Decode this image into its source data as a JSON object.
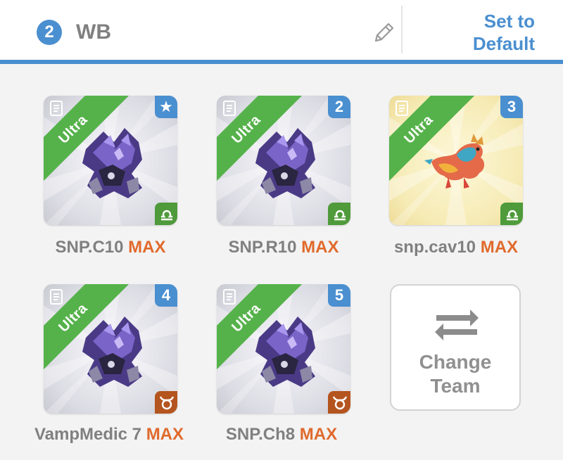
{
  "header": {
    "team_number": "2",
    "team_name": "WB",
    "default_line1": "Set to",
    "default_line2": "Default"
  },
  "colors": {
    "accent": "#4a8fd0",
    "ultra_green": "#55b24a",
    "max_orange": "#e06a2c",
    "label_gray": "#808080"
  },
  "cards": [
    {
      "ultra": "Ultra",
      "badge": "★",
      "name": "SNP.C10",
      "max": "MAX",
      "element_icon": "libra-icon",
      "element_color": "green",
      "background": "silver",
      "monster_icon": "dark-armored-monster-icon"
    },
    {
      "ultra": "Ultra",
      "badge": "2",
      "name": "SNP.R10",
      "max": "MAX",
      "element_icon": "libra-icon",
      "element_color": "green",
      "background": "silver",
      "monster_icon": "dark-armored-monster-icon"
    },
    {
      "ultra": "Ultra",
      "badge": "3",
      "name": "snp.cav10",
      "max": "MAX",
      "element_icon": "libra-icon",
      "element_color": "green",
      "background": "gold",
      "monster_icon": "dragon-monster-icon"
    },
    {
      "ultra": "Ultra",
      "badge": "4",
      "name": "VampMedic 7",
      "max": "MAX",
      "element_icon": "taurus-icon",
      "element_color": "brown",
      "background": "silver",
      "monster_icon": "dark-armored-monster-icon"
    },
    {
      "ultra": "Ultra",
      "badge": "5",
      "name": "SNP.Ch8",
      "max": "MAX",
      "element_icon": "taurus-icon",
      "element_color": "brown",
      "background": "silver",
      "monster_icon": "dark-armored-monster-icon"
    }
  ],
  "change_team": {
    "line1": "Change",
    "line2": "Team",
    "icon": "swap-arrows-icon"
  }
}
